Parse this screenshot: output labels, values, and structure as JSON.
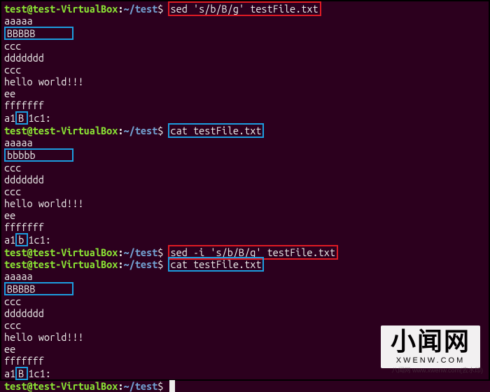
{
  "prompt": {
    "user": "test@test-VirtualBox",
    "sep": ":",
    "path": "~/test",
    "dollar": "$ "
  },
  "cmd1": "sed 's/b/B/g' testFile.txt",
  "out1": {
    "l1": "aaaaa",
    "l2a": "BBBBB",
    "l2b": "",
    "l3": "ccc",
    "l4": "ddddddd",
    "l5": "ccc",
    "l6": "hello world!!!",
    "l7": "ee",
    "l8": "fffffff",
    "l9a": "a1",
    "l9b": "B",
    "l9c": "1c1:"
  },
  "cmd2": "cat testFile.txt",
  "out2": {
    "l1": "aaaaa",
    "l2a": "bbbbb",
    "l2b": "",
    "l3": "ccc",
    "l4": "ddddddd",
    "l5": "ccc",
    "l6": "hello world!!!",
    "l7": "ee",
    "l8": "fffffff",
    "l9a": "a1",
    "l9b": "b",
    "l9c": "1c1:"
  },
  "cmd3": "sed -i 's/b/B/g' testFile.txt",
  "cmd4": "cat testFile.txt",
  "out3": {
    "l1": "aaaaa",
    "l2a": "BBBBB",
    "l2b": "",
    "l3": "ccc",
    "l4": "ddddddd",
    "l5": "ccc",
    "l6": "hello world!!!",
    "l7": "ee",
    "l8": "fffffff",
    "l9a": "a1",
    "l9b": "B",
    "l9c": "1c1:"
  },
  "watermark": {
    "main": "小闻网",
    "sub": "XWENW.COM",
    "hint": "八闻网 www.xwenw.com(去水印)"
  }
}
